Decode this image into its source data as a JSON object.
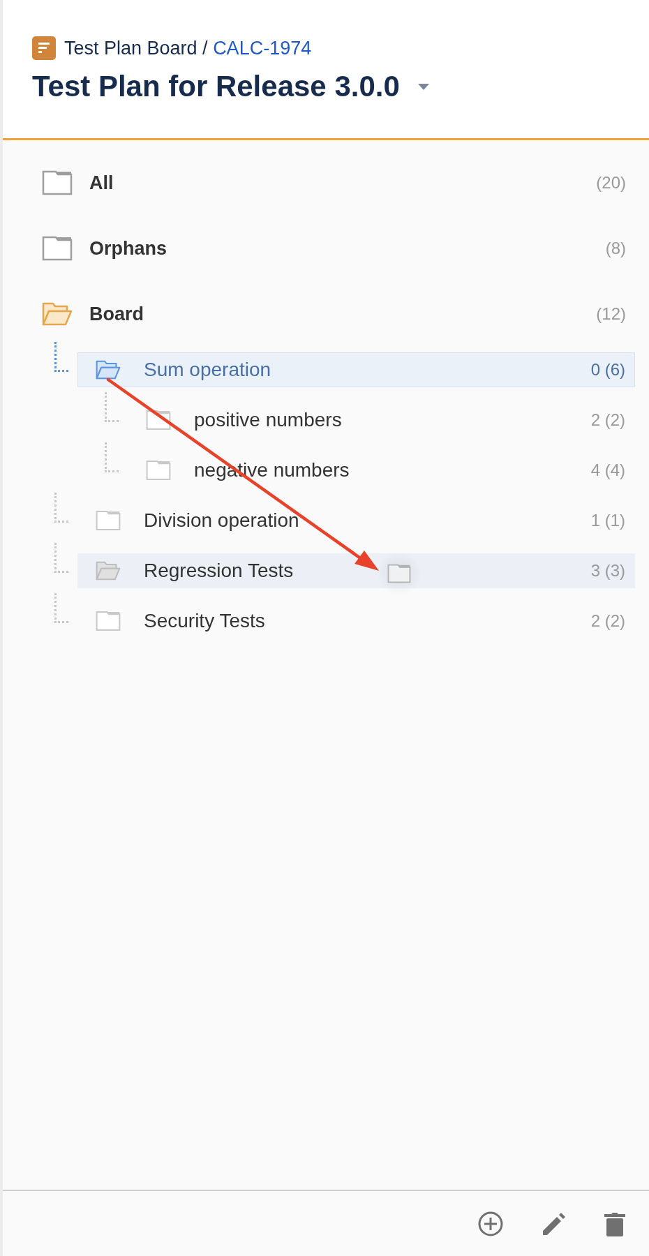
{
  "breadcrumb": {
    "board": "Test Plan Board / ",
    "issue_key": "CALC-1974"
  },
  "title": "Test Plan for Release 3.0.0",
  "tree": [
    {
      "label": "All",
      "count": "(20)",
      "expanded": false
    },
    {
      "label": "Orphans",
      "count": "(8)",
      "expanded": false
    },
    {
      "label": "Board",
      "count": "(12)",
      "expanded": true,
      "children": [
        {
          "label": "Sum operation",
          "count": "0 (6)",
          "selected": true,
          "drop_target": false,
          "expanded": true,
          "children": [
            {
              "label": "positive numbers",
              "count": "2 (2)",
              "selected": false,
              "drop_target": false
            },
            {
              "label": "negative numbers",
              "count": "4 (4)",
              "selected": false,
              "drop_target": false
            }
          ]
        },
        {
          "label": "Division operation",
          "count": "1 (1)",
          "selected": false,
          "drop_target": false
        },
        {
          "label": "Regression Tests",
          "count": "3 (3)",
          "selected": false,
          "drop_target": true
        },
        {
          "label": "Security Tests",
          "count": "2 (2)",
          "selected": false,
          "drop_target": false
        }
      ]
    }
  ]
}
